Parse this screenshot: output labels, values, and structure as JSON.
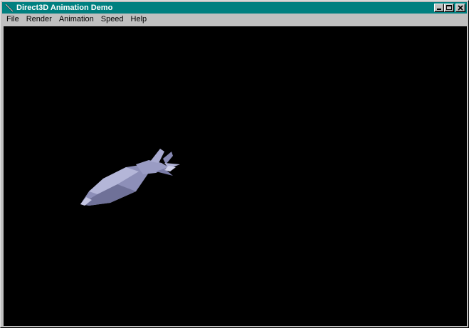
{
  "window": {
    "title": "Direct3D Animation Demo",
    "title_color": "#008080",
    "icon": "arrow-pointer-icon"
  },
  "title_buttons": [
    "minimize-icon",
    "maximize-icon",
    "close-icon"
  ],
  "menu": {
    "items": [
      "File",
      "Render",
      "Animation",
      "Speed",
      "Help"
    ]
  },
  "viewport": {
    "background": "#000000",
    "object": "spaceship-model",
    "object_color": "#9a9cc4"
  }
}
